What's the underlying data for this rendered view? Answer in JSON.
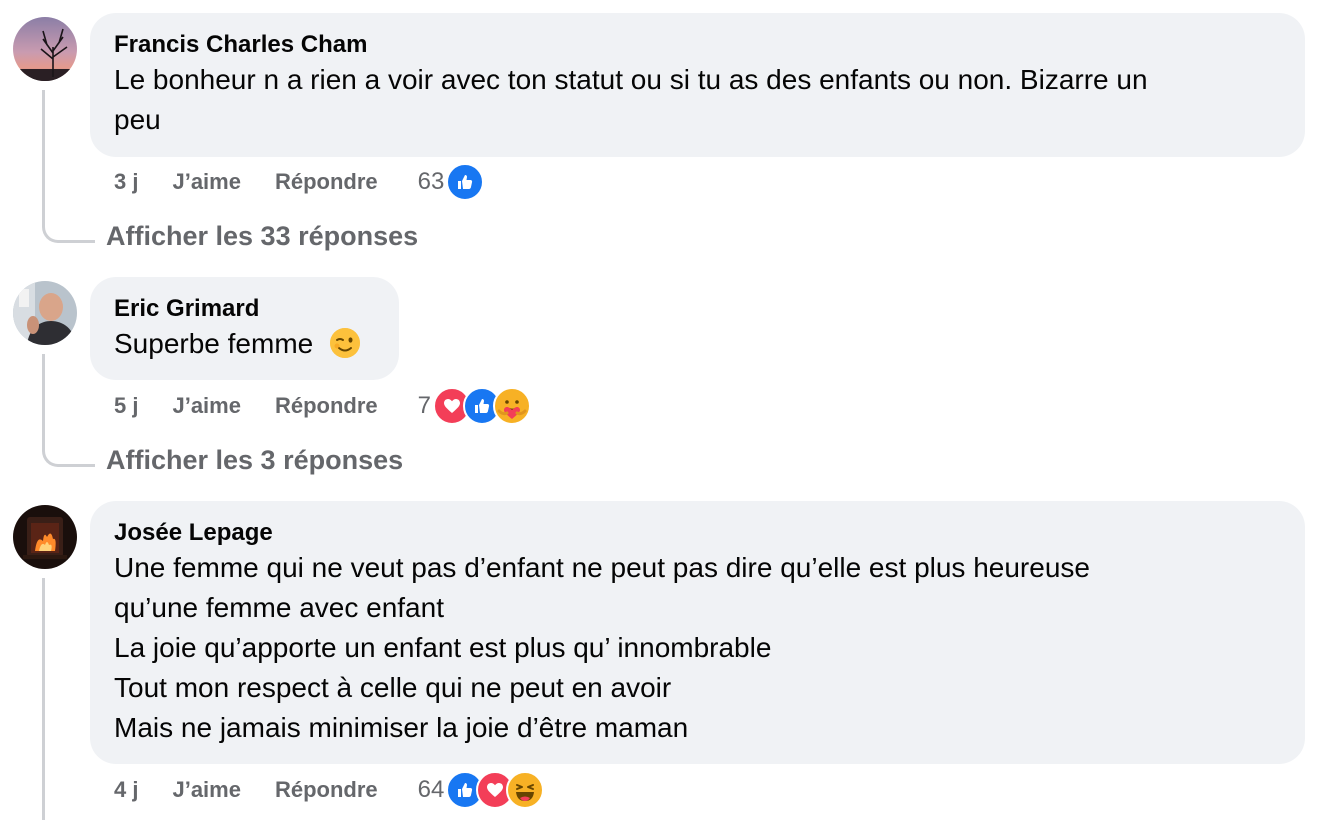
{
  "comments": [
    {
      "author": "Francis Charles Cham",
      "text_lines": [
        "Le bonheur n a rien a voir avec ton statut ou si tu as des enfants ou non. Bizarre un",
        "peu"
      ],
      "time": "3 j",
      "like_label": "J’aime",
      "reply_label": "Répondre",
      "reaction_count": "63",
      "reactions": [
        "like-icon"
      ],
      "replies_label": "Afficher les 33 réponses"
    },
    {
      "author": "Eric Grimard",
      "text": "Superbe femme",
      "emoji": "winking-face-icon",
      "time": "5 j",
      "like_label": "J’aime",
      "reply_label": "Répondre",
      "reaction_count": "7",
      "reactions": [
        "love-icon",
        "like-icon",
        "care-icon"
      ],
      "replies_label": "Afficher les 3 réponses"
    },
    {
      "author": "Josée Lepage",
      "text_lines": [
        "Une femme qui ne veut pas d’enfant ne peut pas dire qu’elle est plus heureuse",
        "qu’une femme avec enfant",
        "La joie qu’apporte un enfant est plus qu’ innombrable",
        "Tout mon respect à celle qui ne peut en avoir",
        "Mais ne jamais minimiser la joie d’être maman"
      ],
      "time": "4 j",
      "like_label": "J’aime",
      "reply_label": "Répondre",
      "reaction_count": "64",
      "reactions": [
        "like-icon",
        "love-icon",
        "haha-icon"
      ]
    }
  ],
  "colors": {
    "bubble": "#f0f2f5",
    "secondary_text": "#65676b",
    "like_blue": "#1877f2",
    "love_red": "#f33e58",
    "emoji_yellow": "#f7b125"
  }
}
